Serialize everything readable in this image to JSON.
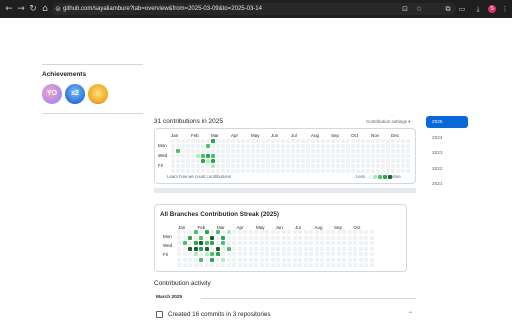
{
  "browser": {
    "url": "github.com/sayaliambure?tab=overview&from=2025-03-09&to=2025-03-14",
    "profile_initial": "S"
  },
  "achievements": {
    "title": "Achievements",
    "badges": [
      {
        "name": "yolo-badge",
        "label": "YO"
      },
      {
        "name": "pull-shark-badge",
        "label": "x2"
      },
      {
        "name": "starstruck-badge",
        "label": ""
      }
    ]
  },
  "contributions": {
    "title": "31 contributions in 2025",
    "settings_label": "Contribution settings ▾",
    "months": [
      "Jan",
      "Feb",
      "Mar",
      "Apr",
      "May",
      "Jun",
      "Jul",
      "Aug",
      "Sep",
      "Oct",
      "Nov",
      "Dec"
    ],
    "days": [
      "Mon",
      "Wed",
      "Fri"
    ],
    "learn_link": "Learn how we count contributions",
    "legend_less": "Less",
    "legend_more": "More",
    "active_cells": [
      {
        "week": 1,
        "day": 2,
        "level": 2
      },
      {
        "week": 5,
        "day": 3,
        "level": 1
      },
      {
        "week": 6,
        "day": 3,
        "level": 2
      },
      {
        "week": 6,
        "day": 4,
        "level": 3
      },
      {
        "week": 7,
        "day": 1,
        "level": 2
      },
      {
        "week": 7,
        "day": 3,
        "level": 3
      },
      {
        "week": 7,
        "day": 4,
        "level": 1
      },
      {
        "week": 8,
        "day": 0,
        "level": 3
      },
      {
        "week": 8,
        "day": 3,
        "level": 2
      },
      {
        "week": 8,
        "day": 4,
        "level": 3
      },
      {
        "week": 8,
        "day": 5,
        "level": 1
      }
    ]
  },
  "streak": {
    "title": "All Branches Contribution Streak (2025)",
    "months": [
      "Jan",
      "Feb",
      "Mar",
      "Apr",
      "May",
      "Jun",
      "Jul",
      "Aug",
      "Sep",
      "Oct"
    ],
    "days": [
      "Mon",
      "Wed",
      "Fri"
    ],
    "active_cells": [
      {
        "week": 1,
        "day": 2,
        "level": 2
      },
      {
        "week": 2,
        "day": 1,
        "level": 3
      },
      {
        "week": 2,
        "day": 3,
        "level": 4
      },
      {
        "week": 3,
        "day": 0,
        "level": 2
      },
      {
        "week": 3,
        "day": 2,
        "level": 3
      },
      {
        "week": 3,
        "day": 3,
        "level": 4
      },
      {
        "week": 3,
        "day": 4,
        "level": 1
      },
      {
        "week": 4,
        "day": 1,
        "level": 2
      },
      {
        "week": 4,
        "day": 2,
        "level": 4
      },
      {
        "week": 4,
        "day": 3,
        "level": 3
      },
      {
        "week": 4,
        "day": 5,
        "level": 2
      },
      {
        "week": 5,
        "day": 0,
        "level": 3
      },
      {
        "week": 5,
        "day": 2,
        "level": 2
      },
      {
        "week": 5,
        "day": 3,
        "level": 4
      },
      {
        "week": 5,
        "day": 4,
        "level": 1
      },
      {
        "week": 6,
        "day": 1,
        "level": 4
      },
      {
        "week": 6,
        "day": 2,
        "level": 3
      },
      {
        "week": 6,
        "day": 4,
        "level": 2
      },
      {
        "week": 6,
        "day": 5,
        "level": 3
      },
      {
        "week": 7,
        "day": 0,
        "level": 2
      },
      {
        "week": 7,
        "day": 3,
        "level": 4
      },
      {
        "week": 7,
        "day": 4,
        "level": 3
      },
      {
        "week": 8,
        "day": 1,
        "level": 3
      },
      {
        "week": 8,
        "day": 2,
        "level": 2
      },
      {
        "week": 8,
        "day": 5,
        "level": 1
      },
      {
        "week": 9,
        "day": 0,
        "level": 1
      },
      {
        "week": 9,
        "day": 3,
        "level": 2
      }
    ]
  },
  "activity": {
    "title": "Contribution activity",
    "month_heading": "March 2025",
    "item": "Created 16 commits in 3 repositories"
  },
  "years": [
    "2025",
    "2024",
    "2023",
    "2022",
    "2021"
  ],
  "selected_year": "2025",
  "colors": {
    "accent": "#0969da",
    "level1": "#aceebb",
    "level2": "#4ac26b",
    "level3": "#2da44e",
    "level4": "#116329",
    "empty": "#eff2f5"
  }
}
